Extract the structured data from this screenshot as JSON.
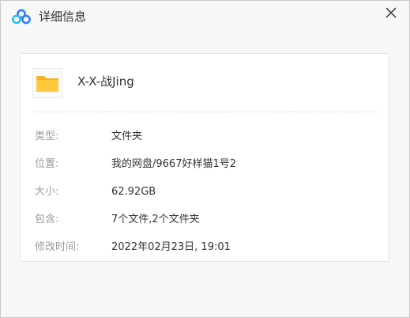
{
  "window": {
    "title": "详细信息",
    "close_icon": "close-icon",
    "logo_icon": "cloud-logo-icon",
    "colors": {
      "logo_blue": "#2f7ff5",
      "logo_cyan": "#27c2e8",
      "folder_yellow": "#ffc83d"
    }
  },
  "item": {
    "icon": "folder-icon",
    "name": "X-X-战Jing"
  },
  "details": [
    {
      "label": "类型:",
      "value": "文件夹"
    },
    {
      "label": "位置:",
      "value": "我的网盘/9667好样猫1号2"
    },
    {
      "label": "大小:",
      "value": "62.92GB"
    },
    {
      "label": "包含:",
      "value": "7个文件,2个文件夹"
    },
    {
      "label": "修改时间:",
      "value": "2022年02月23日, 19:01"
    }
  ]
}
